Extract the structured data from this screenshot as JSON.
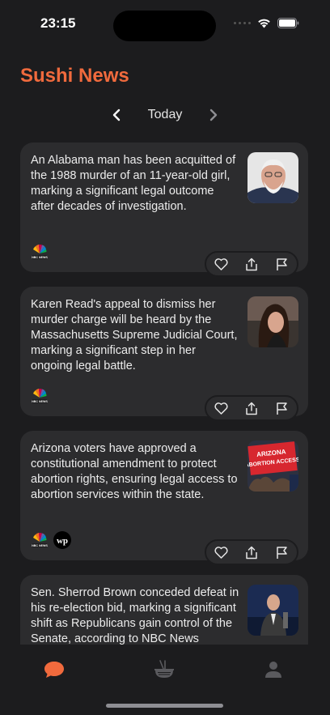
{
  "status": {
    "time": "23:15"
  },
  "app": {
    "title": "Sushi News",
    "accent": "#f06a3d"
  },
  "date_nav": {
    "label": "Today",
    "prev_icon": "chevron-left-icon",
    "next_icon": "chevron-right-icon"
  },
  "articles": [
    {
      "text": "An Alabama man has been acquitted of the 1988 murder of an 11-year-old girl, marking a significant legal outcome after decades of investigation.",
      "sources": [
        "NBC NEWS"
      ]
    },
    {
      "text": "Karen Read's appeal to dismiss her murder charge will be heard by the Massachusetts Supreme Judicial Court, marking a significant step in her ongoing legal battle.",
      "sources": [
        "NBC NEWS"
      ]
    },
    {
      "text": "Arizona voters have approved a constitutional amendment to protect abortion rights, ensuring legal access to abortion services within the state.",
      "sources": [
        "NBC NEWS",
        "wp"
      ],
      "thumb_text": "ARIZONA ABORTION ACCESS"
    },
    {
      "text": "Sen. Sherrod Brown conceded defeat in his re-election bid, marking a significant shift as Republicans gain control of the Senate, according to NBC News projections.",
      "sources": []
    }
  ],
  "tabs": [
    {
      "icon": "chat-bubble-icon",
      "active": true
    },
    {
      "icon": "ramen-bowl-icon",
      "active": false
    },
    {
      "icon": "person-icon",
      "active": false
    }
  ]
}
